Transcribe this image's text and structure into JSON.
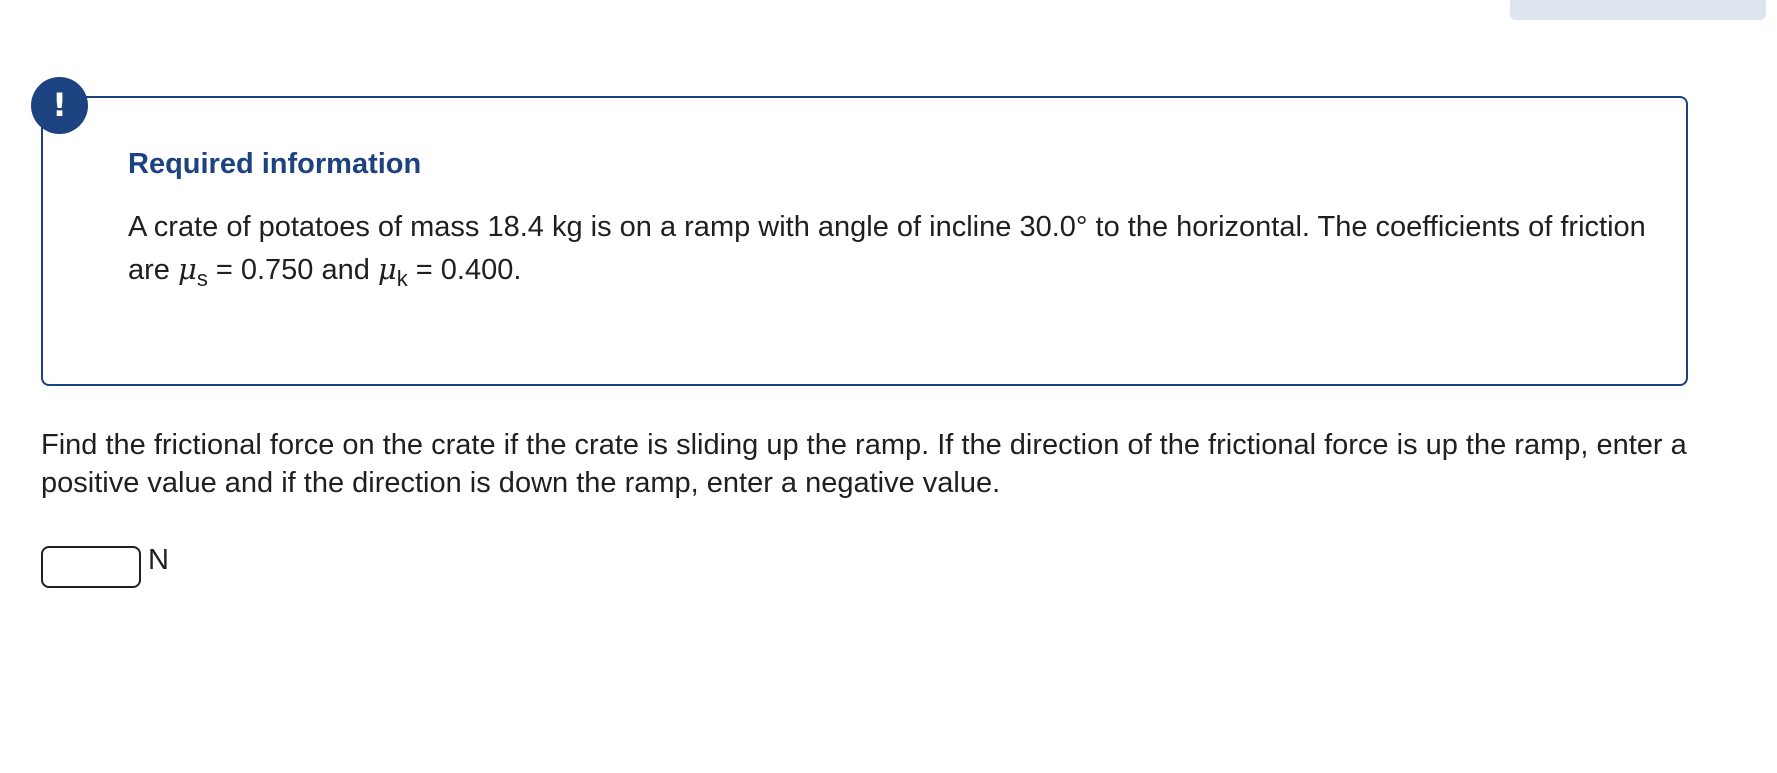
{
  "notice": {
    "icon": "exclamation-icon",
    "icon_glyph": "!",
    "title": "Required information",
    "text_before_mu_s": "A crate of potatoes of mass 18.4 kg is on a ramp with angle of incline 30.0° to the horizontal. The coefficients of friction are ",
    "mu_symbol": "μ",
    "mu_s_subscript": "s",
    "mu_s_value_text": "= 0.750 and ",
    "mu_k_subscript": "k",
    "mu_k_value_text": "= 0.400."
  },
  "question": {
    "text": "Find the frictional force on the crate if the crate is sliding up the ramp. If the direction of the frictional force is up the ramp, enter a positive value and if the direction is down the ramp, enter a negative value.",
    "answer_value": "",
    "answer_placeholder": "",
    "unit": "N"
  },
  "colors": {
    "accent": "#1d4280",
    "text": "#1f1f1f",
    "top_tab": "#dde6ef"
  }
}
